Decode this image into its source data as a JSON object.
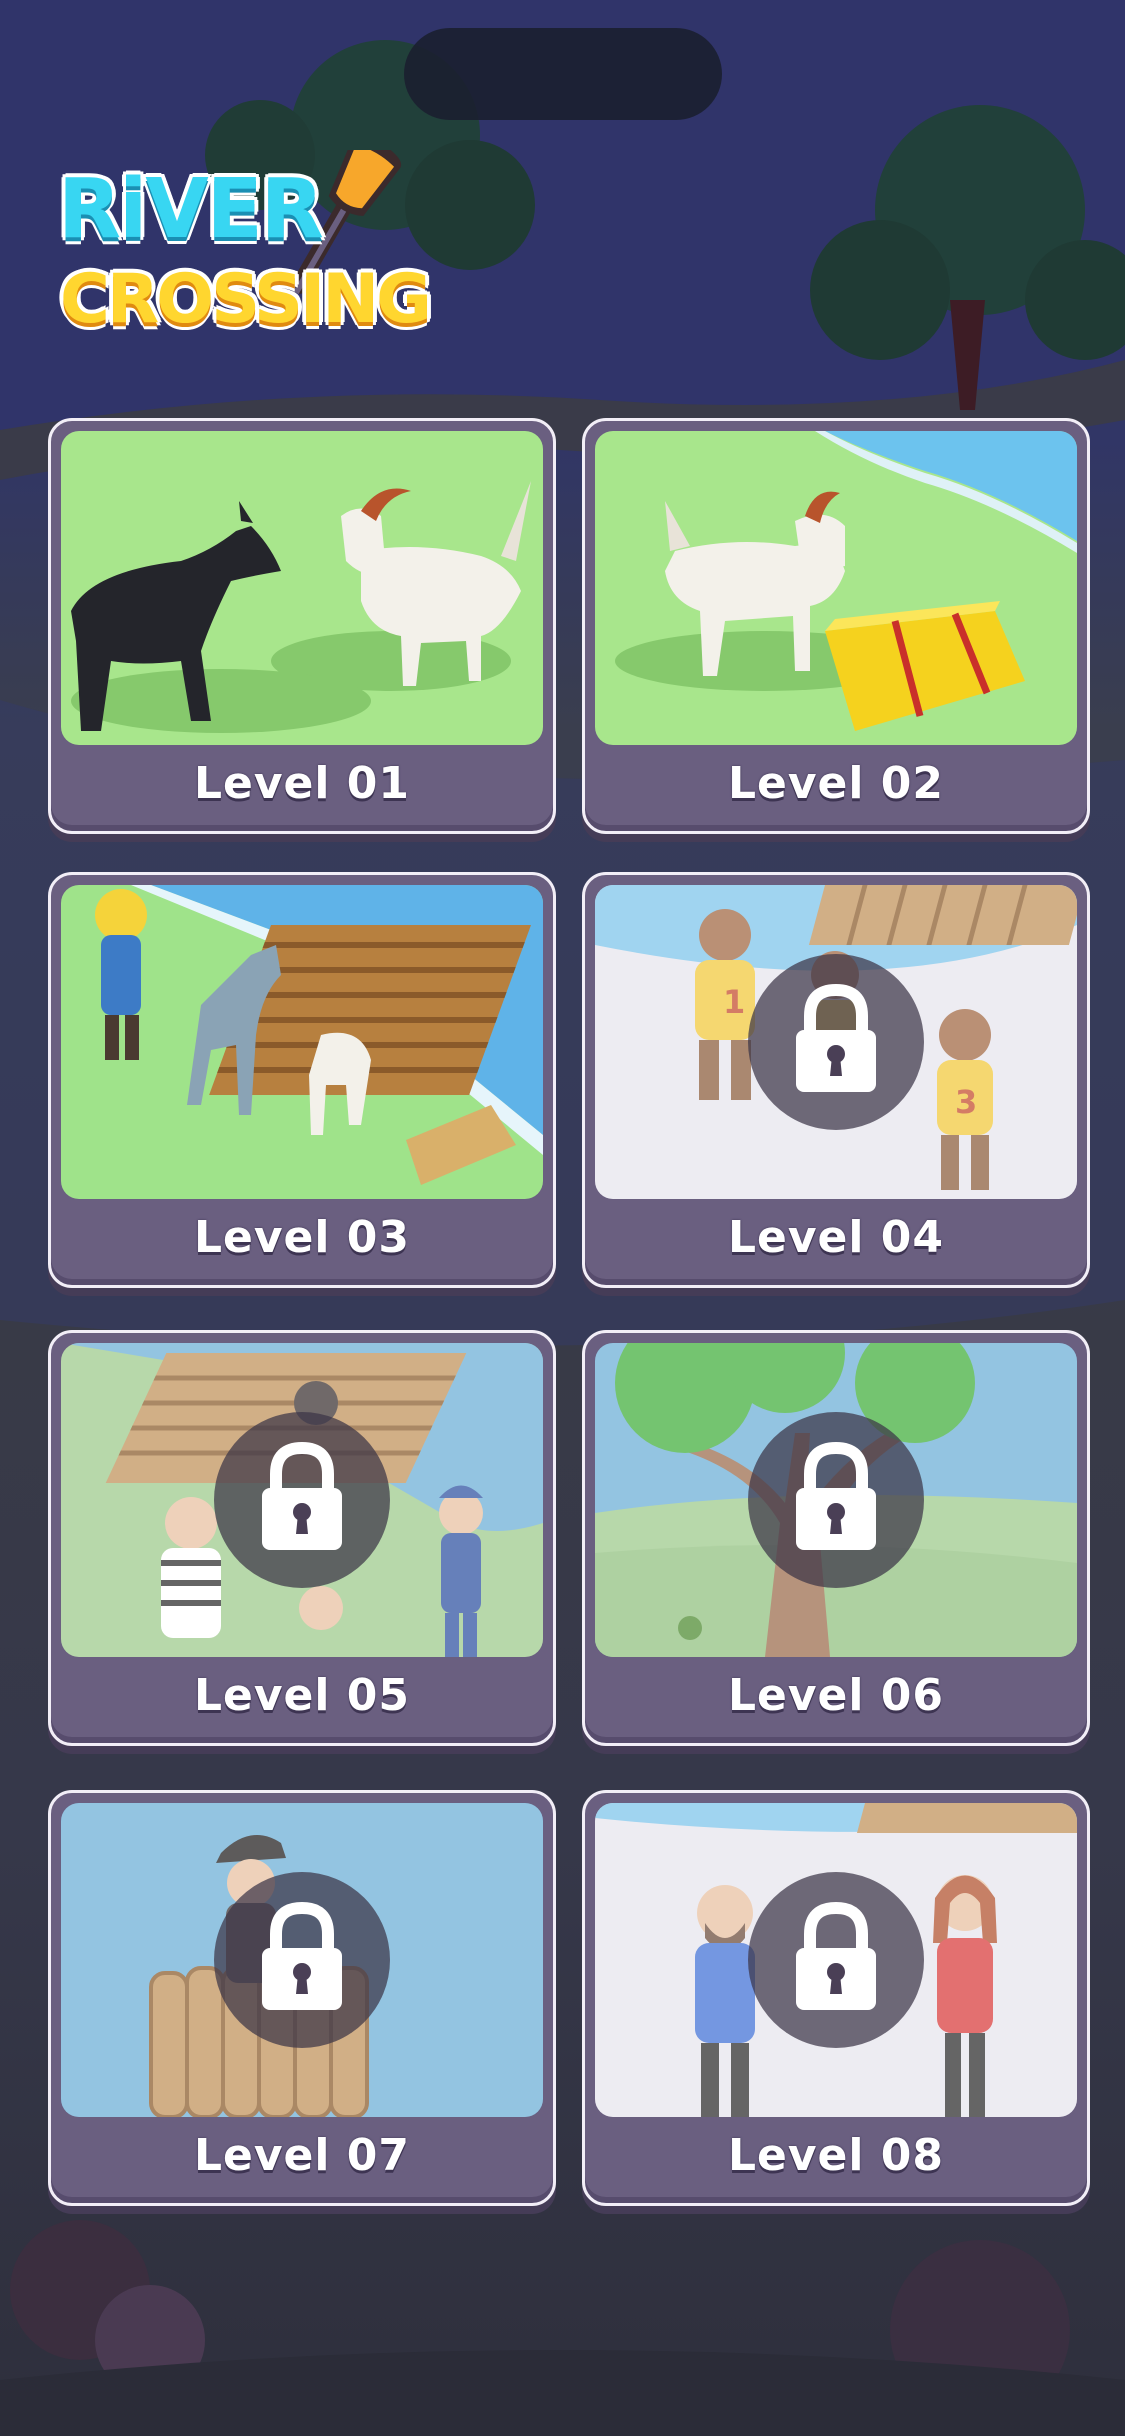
{
  "logo": {
    "line1": "RiVER",
    "line2": "CROSSING"
  },
  "levels": [
    {
      "label": "Level 01",
      "locked": false,
      "scene": "wolf-goat"
    },
    {
      "label": "Level 02",
      "locked": false,
      "scene": "goat-hay"
    },
    {
      "label": "Level 03",
      "locked": false,
      "scene": "farmer-wolf-goat-raft"
    },
    {
      "label": "Level 04",
      "locked": true,
      "scene": "numbered-kids",
      "jersey_numbers": [
        "1",
        "3"
      ]
    },
    {
      "label": "Level 05",
      "locked": true,
      "scene": "robbers-police"
    },
    {
      "label": "Level 06",
      "locked": true,
      "scene": "tree"
    },
    {
      "label": "Level 07",
      "locked": true,
      "scene": "pirate-raft"
    },
    {
      "label": "Level 08",
      "locked": true,
      "scene": "couple"
    }
  ],
  "icons": {
    "lock": "lock-icon"
  },
  "colors": {
    "card": "#6a5f80",
    "card_border": "#f2eef7",
    "grass": "#a6e68a",
    "water": "#5fb3e8"
  }
}
